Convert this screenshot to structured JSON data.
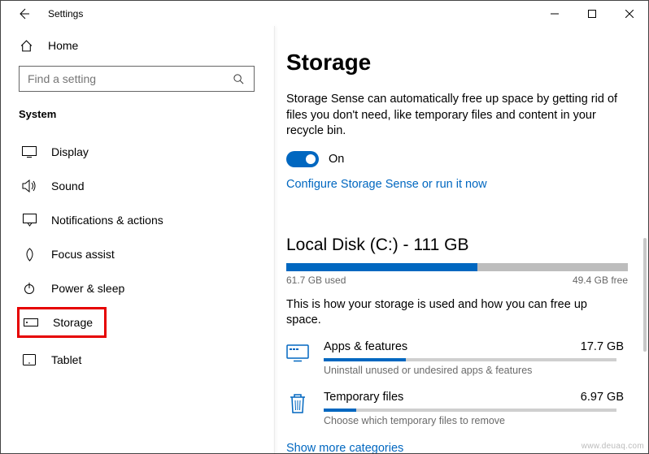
{
  "window": {
    "title": "Settings"
  },
  "sidebar": {
    "home": "Home",
    "search_placeholder": "Find a setting",
    "category": "System",
    "items": [
      {
        "label": "Display"
      },
      {
        "label": "Sound"
      },
      {
        "label": "Notifications & actions"
      },
      {
        "label": "Focus assist"
      },
      {
        "label": "Power & sleep"
      },
      {
        "label": "Storage"
      },
      {
        "label": "Tablet"
      }
    ]
  },
  "main": {
    "title": "Storage",
    "sense_desc": "Storage Sense can automatically free up space by getting rid of files you don't need, like temporary files and content in your recycle bin.",
    "toggle_label": "On",
    "configure_link": "Configure Storage Sense or run it now",
    "disk": {
      "header": "Local Disk (C:) - 111 GB",
      "used_label": "61.7 GB used",
      "free_label": "49.4 GB free",
      "used_pct": 56
    },
    "usage_desc": "This is how your storage is used and how you can free up space.",
    "categories": [
      {
        "name": "Apps & features",
        "size": "17.7 GB",
        "sub": "Uninstall unused or undesired apps & features",
        "pct": 28
      },
      {
        "name": "Temporary files",
        "size": "6.97 GB",
        "sub": "Choose which temporary files to remove",
        "pct": 11
      }
    ],
    "show_more": "Show more categories"
  },
  "watermark": "www.deuaq.com"
}
